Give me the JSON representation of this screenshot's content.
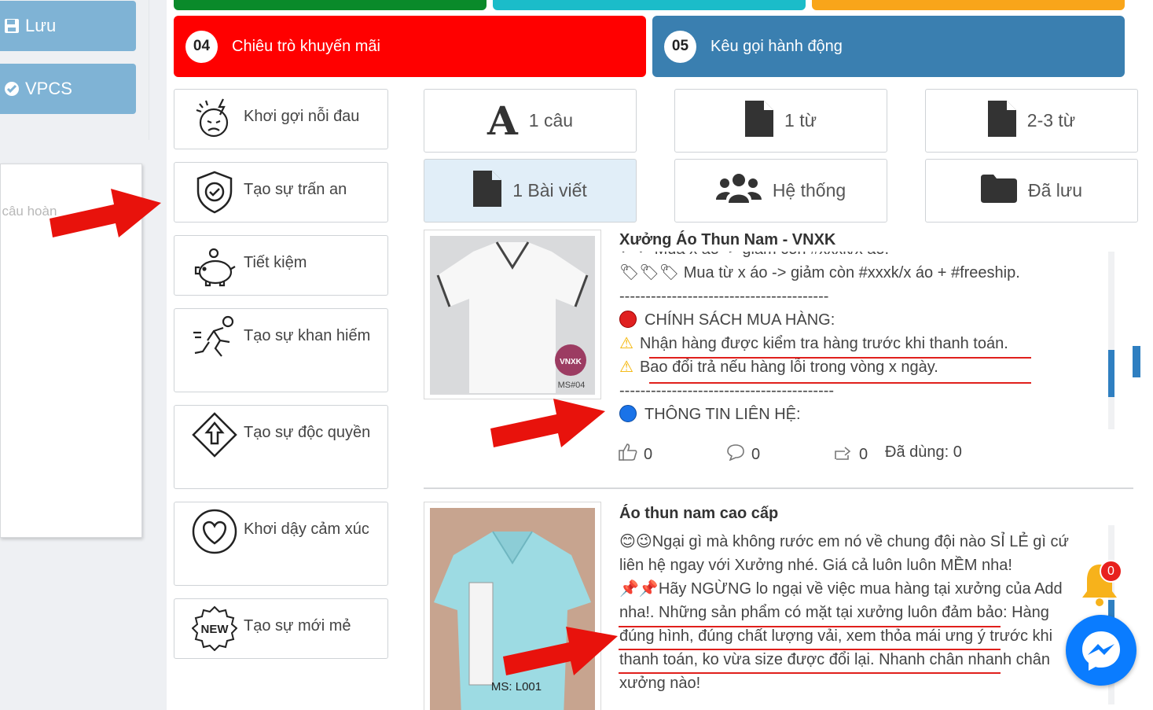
{
  "sidebar": {
    "save_label": "Lưu",
    "vpcs_label": "VPCS",
    "placeholder_fragment": "t câu hoàn"
  },
  "steps": [
    {
      "num": "04",
      "label": "Chiêu trò khuyến mãi",
      "color": "#ff0000"
    },
    {
      "num": "05",
      "label": "Kêu gọi hành động",
      "color": "#3a7fb0"
    }
  ],
  "top_bars": [
    "#0a8a2a",
    "#1bbcc9",
    "#f9a51a"
  ],
  "categories": [
    {
      "icon": "stressed-face-icon",
      "label": "Khơi gợi nỗi đau"
    },
    {
      "icon": "shield-check-icon",
      "label": "Tạo sự trấn an"
    },
    {
      "icon": "piggy-bank-icon",
      "label": "Tiết kiệm"
    },
    {
      "icon": "running-person-icon",
      "label": "Tạo sự khan hiếm"
    },
    {
      "icon": "exclusive-arrow-icon",
      "label": "Tạo sự độc quyền"
    },
    {
      "icon": "heart-icon",
      "label": "Khơi dậy cảm xúc"
    },
    {
      "icon": "new-badge-icon",
      "label": "Tạo sự mới mẻ"
    }
  ],
  "filters": [
    {
      "icon": "letter-a-icon",
      "label": "1 câu"
    },
    {
      "icon": "document-icon",
      "label": "1 từ"
    },
    {
      "icon": "document-icon",
      "label": "2-3 từ"
    },
    {
      "icon": "document-icon",
      "label": "1 Bài viết",
      "active": true
    },
    {
      "icon": "users-icon",
      "label": "Hệ thống"
    },
    {
      "icon": "folder-icon",
      "label": "Đã lưu"
    }
  ],
  "posts": [
    {
      "title": "Xưởng Áo Thun Nam - VNXK",
      "image_label": "MS#04",
      "lines": [
        "Mua x áo -> giảm còn #xxxk/x áo.",
        "Mua từ x áo -> giảm còn #xxxk/x áo + #freeship.",
        "----------------------------------------",
        "CHÍNH SÁCH MUA HÀNG:",
        "Nhận hàng được kiểm tra hàng trước khi thanh toán.",
        "Bao đổi trả nếu hàng lỗi trong vòng x ngày.",
        "-----------------------------------------",
        "THÔNG TIN LIÊN HỆ:"
      ],
      "likes": "0",
      "comments": "0",
      "shares": "0",
      "used": "Đã dùng: 0"
    },
    {
      "title": "Áo thun nam cao cấp",
      "image_label": "MS: L001",
      "lines": [
        "Ngại gì mà không rước em nó về chung đội nào SỈ LẺ gì cứ",
        "liên hệ ngay với Xưởng nhé. Giá cả luôn luôn MỀM nha!",
        "Hãy NGỪNG lo ngại về việc mua hàng tại xưởng của Add",
        "nha!. Những sản phẩm có mặt tại xưởng luôn đảm bảo: Hàng",
        "đúng hình, đúng chất lượng vải, xem thỏa mái ưng ý trước khi",
        "thanh toán, ko vừa size được đổi lại. Nhanh chân nhanh chân",
        "xưởng nào!"
      ]
    }
  ],
  "notification_count": "0",
  "colors": {
    "accent": "#2f7fc1",
    "arrow": "#e8120c",
    "messenger": "#0a7cff"
  }
}
